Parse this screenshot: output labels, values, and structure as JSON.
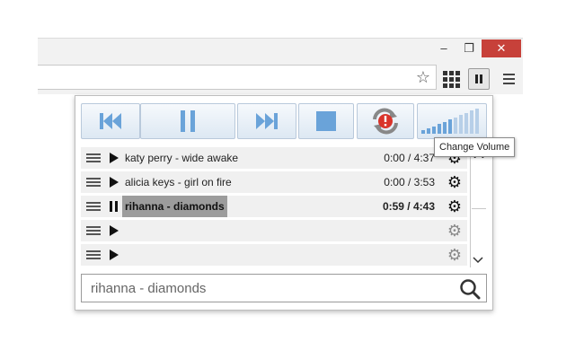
{
  "window": {
    "minimize_glyph": "–",
    "maximize_glyph": "❐",
    "close_glyph": "✕"
  },
  "toolbar": {
    "star_glyph": "☆"
  },
  "controls": {
    "buttons": [
      "previous",
      "pause",
      "next",
      "stop",
      "repeat-error",
      "volume"
    ],
    "accent_color": "#6aa3d9",
    "error_badge_color": "#d9342b",
    "error_badge_text": "!"
  },
  "tooltip": {
    "text": "Change Volume"
  },
  "playlist": {
    "rows": [
      {
        "title": "katy perry - wide awake",
        "time": "0:00 / 4:37",
        "state": "play",
        "active": false
      },
      {
        "title": "alicia keys - girl on fire",
        "time": "0:00 / 3:53",
        "state": "play",
        "active": false
      },
      {
        "title": "rihanna - diamonds",
        "time": "0:59 / 4:43",
        "state": "pause",
        "active": true
      },
      {
        "title": "",
        "time": "",
        "state": "play",
        "active": false
      },
      {
        "title": "",
        "time": "",
        "state": "play",
        "active": false
      }
    ],
    "gear_glyph": "⚙"
  },
  "search": {
    "value": "rihanna - diamonds"
  }
}
